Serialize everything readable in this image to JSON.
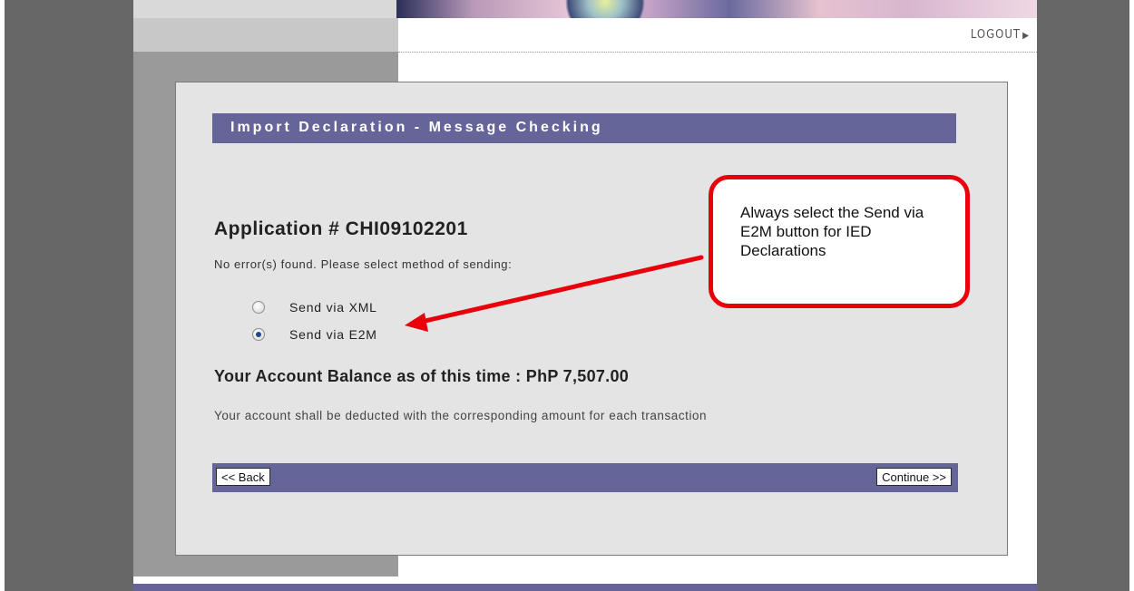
{
  "header": {
    "logout_label": "LOGOUT",
    "logout_icon": "triangle-right-icon"
  },
  "panel": {
    "title": "Import Declaration - Message Checking",
    "application_number": "Application # CHI09102201",
    "message": "No error(s) found. Please select method of sending:",
    "send_options": [
      {
        "label": "Send via XML",
        "selected": false
      },
      {
        "label": "Send via E2M",
        "selected": true
      }
    ],
    "balance": "Your Account Balance as of this time : PhP 7,507.00",
    "note": "Your account shall be deducted with the corresponding amount for each transaction",
    "back_label": "<< Back",
    "continue_label": "Continue >>"
  },
  "annotation": {
    "callout_text": "Always select the Send via E2M button for IED Declarations",
    "border_color": "#e8000b"
  },
  "colors": {
    "accent": "#66659a",
    "frame_gray": "#676767",
    "panel_bg": "#e4e4e4"
  }
}
